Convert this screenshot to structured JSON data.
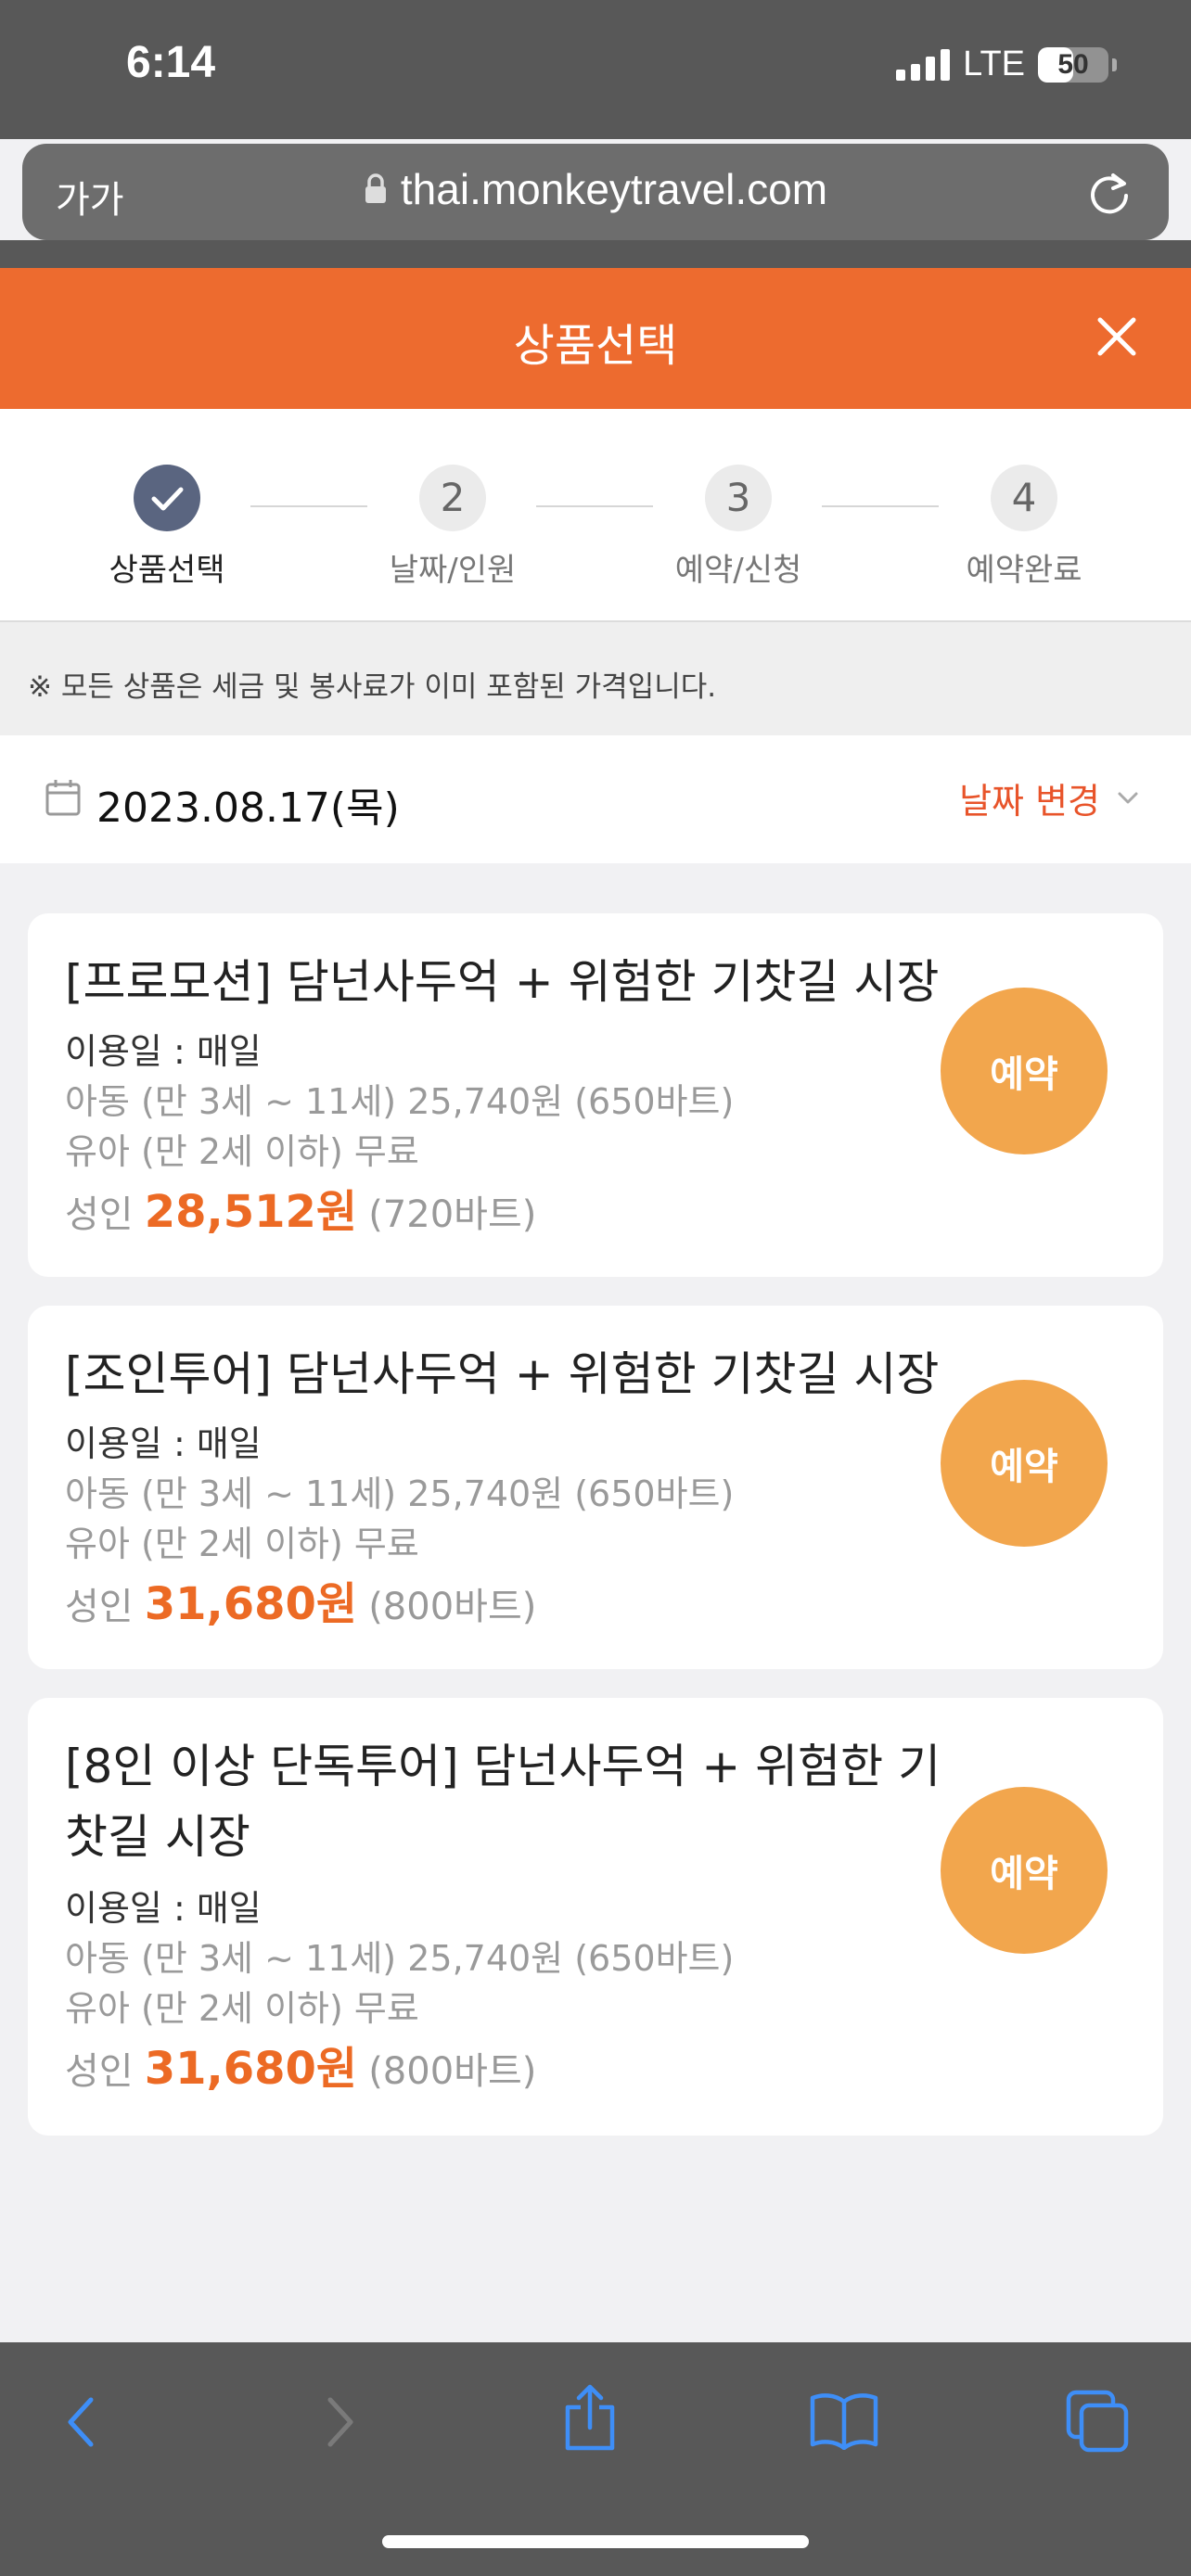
{
  "status_bar": {
    "time": "6:14",
    "network": "LTE",
    "battery": "50",
    "battery_level": 0.5
  },
  "browser": {
    "aa_label": "가가",
    "url": "thai.monkeytravel.com"
  },
  "header": {
    "title": "상품선택"
  },
  "steps": [
    {
      "number": "",
      "label": "상품선택",
      "status": "done"
    },
    {
      "number": "2",
      "label": "날짜/인원",
      "status": "pending"
    },
    {
      "number": "3",
      "label": "예약/신청",
      "status": "pending"
    },
    {
      "number": "4",
      "label": "예약완료",
      "status": "pending"
    }
  ],
  "notice": "※ 모든 상품은 세금 및 봉사료가 이미 포함된 가격입니다.",
  "date_row": {
    "date": "2023.08.17(목)",
    "change_label": "날짜 변경"
  },
  "products": [
    {
      "title": "[프로모션] 담넌사두억 + 위험한 기찻길 시장",
      "usage": "이용일 : 매일",
      "child": "아동 (만 3세 ~ 11세) 25,740원 (650바트)",
      "infant": "유아 (만 2세 이하) 무료",
      "adult_label": "성인",
      "adult_price": "28,512원",
      "adult_baht": "(720바트)",
      "button": "예약"
    },
    {
      "title": "[조인투어] 담넌사두억 + 위험한 기찻길 시장",
      "usage": "이용일 : 매일",
      "child": "아동 (만 3세 ~ 11세) 25,740원 (650바트)",
      "infant": "유아 (만 2세 이하) 무료",
      "adult_label": "성인",
      "adult_price": "31,680원",
      "adult_baht": "(800바트)",
      "button": "예약"
    },
    {
      "title_line1": "[8인 이상 단독투어] 담넌사두억 + 위험한 기",
      "title_line2": "찻길 시장",
      "usage": "이용일 : 매일",
      "child": "아동 (만 3세 ~ 11세) 25,740원 (650바트)",
      "infant": "유아 (만 2세 이하) 무료",
      "adult_label": "성인",
      "adult_price": "31,680원",
      "adult_baht": "(800바트)",
      "button": "예약"
    }
  ],
  "colors": {
    "accent": "#ed6b2f",
    "button": "#f2a64d",
    "price": "#ec6a24",
    "icon_blue": "#3e8ef7"
  },
  "toolbar_icons": [
    "back-icon",
    "forward-icon",
    "share-icon",
    "bookmarks-icon",
    "tabs-icon"
  ]
}
